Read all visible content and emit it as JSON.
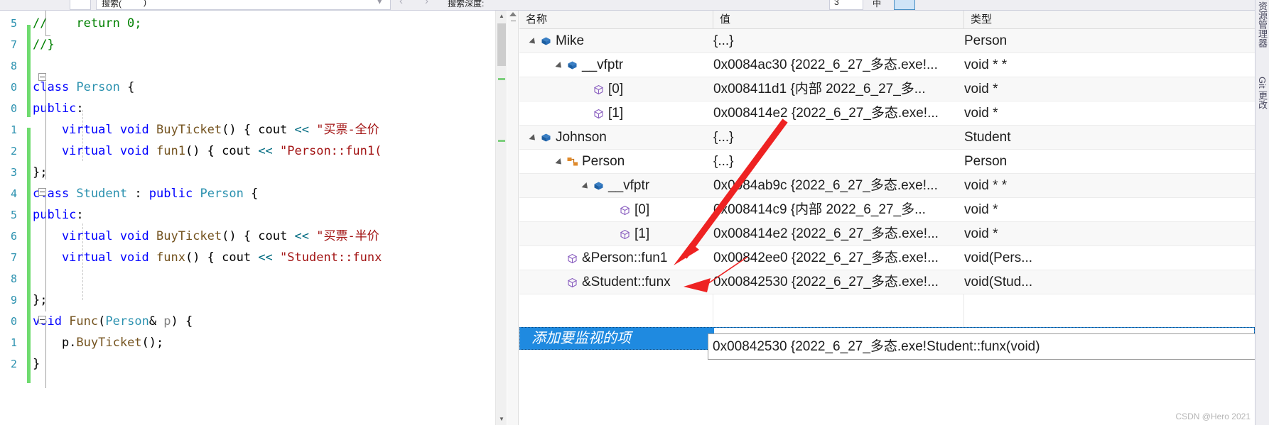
{
  "toolbar": {
    "search_dropdown_placeholder": "搜索(",
    "search_dropdown_suffix": ")",
    "search_depth_label": "搜索深度:",
    "search_depth_value": "3",
    "prev_arrow": "‹",
    "next_arrow": "›"
  },
  "editor": {
    "line_numbers": [
      "5",
      "7",
      "8",
      "0",
      "0",
      "1",
      "2",
      "3",
      "4",
      "5",
      "6",
      "7",
      "8",
      "9",
      "0",
      "1",
      "2"
    ],
    "lines": [
      {
        "indent": 0,
        "tokens": [
          {
            "t": "//    return 0;",
            "c": "cmt"
          }
        ]
      },
      {
        "indent": 0,
        "tokens": [
          {
            "t": "//}",
            "c": "cmt"
          }
        ]
      },
      {
        "indent": 0,
        "tokens": []
      },
      {
        "indent": 0,
        "tokens": [
          {
            "t": "class ",
            "c": "kw"
          },
          {
            "t": "Person",
            "c": "type"
          },
          {
            "t": " {",
            "c": "plain"
          }
        ]
      },
      {
        "indent": 0,
        "tokens": [
          {
            "t": "public",
            "c": "kw"
          },
          {
            "t": ":",
            "c": "plain"
          }
        ]
      },
      {
        "indent": 0,
        "tokens": [
          {
            "t": "    virtual void ",
            "c": "kw"
          },
          {
            "t": "BuyTicket",
            "c": "fn"
          },
          {
            "t": "() { cout ",
            "c": "plain"
          },
          {
            "t": "<<",
            "c": "op"
          },
          {
            "t": " \"买票-全价",
            "c": "str"
          }
        ]
      },
      {
        "indent": 0,
        "tokens": [
          {
            "t": "    virtual void ",
            "c": "kw"
          },
          {
            "t": "fun1",
            "c": "fn"
          },
          {
            "t": "() { cout ",
            "c": "plain"
          },
          {
            "t": "<<",
            "c": "op"
          },
          {
            "t": " \"Person::fun1(",
            "c": "str"
          }
        ]
      },
      {
        "indent": 0,
        "tokens": [
          {
            "t": "};",
            "c": "plain"
          }
        ]
      },
      {
        "indent": 0,
        "tokens": [
          {
            "t": "class ",
            "c": "kw"
          },
          {
            "t": "Student",
            "c": "type"
          },
          {
            "t": " : ",
            "c": "plain"
          },
          {
            "t": "public ",
            "c": "kw"
          },
          {
            "t": "Person",
            "c": "type"
          },
          {
            "t": " {",
            "c": "plain"
          }
        ]
      },
      {
        "indent": 0,
        "tokens": [
          {
            "t": "public",
            "c": "kw"
          },
          {
            "t": ":",
            "c": "plain"
          }
        ]
      },
      {
        "indent": 0,
        "tokens": [
          {
            "t": "    virtual void ",
            "c": "kw"
          },
          {
            "t": "BuyTicket",
            "c": "fn"
          },
          {
            "t": "() { cout ",
            "c": "plain"
          },
          {
            "t": "<<",
            "c": "op"
          },
          {
            "t": " \"买票-半价",
            "c": "str"
          }
        ]
      },
      {
        "indent": 0,
        "tokens": [
          {
            "t": "    virtual void ",
            "c": "kw"
          },
          {
            "t": "funx",
            "c": "fn"
          },
          {
            "t": "() { cout ",
            "c": "plain"
          },
          {
            "t": "<<",
            "c": "op"
          },
          {
            "t": " \"Student::funx",
            "c": "str"
          }
        ]
      },
      {
        "indent": 0,
        "tokens": []
      },
      {
        "indent": 0,
        "tokens": [
          {
            "t": "};",
            "c": "plain"
          }
        ]
      },
      {
        "indent": 0,
        "tokens": [
          {
            "t": "void ",
            "c": "kw"
          },
          {
            "t": "Func",
            "c": "fn"
          },
          {
            "t": "(",
            "c": "plain"
          },
          {
            "t": "Person",
            "c": "type"
          },
          {
            "t": "& ",
            "c": "plain"
          },
          {
            "t": "p",
            "c": "par"
          },
          {
            "t": ") {",
            "c": "plain"
          }
        ]
      },
      {
        "indent": 0,
        "tokens": [
          {
            "t": "    p.",
            "c": "plain"
          },
          {
            "t": "BuyTicket",
            "c": "fn"
          },
          {
            "t": "();",
            "c": "plain"
          }
        ]
      },
      {
        "indent": 0,
        "tokens": [
          {
            "t": "}",
            "c": "plain"
          }
        ]
      }
    ]
  },
  "watch": {
    "columns": [
      "名称",
      "值",
      "类型"
    ],
    "rows": [
      {
        "depth": 0,
        "expander": "expanded",
        "icon": "blue-cube",
        "name": "Mike",
        "value": "{...}",
        "type": "Person"
      },
      {
        "depth": 1,
        "expander": "expanded",
        "icon": "blue-cube",
        "name": "__vfptr",
        "value": "0x0084ac30 {2022_6_27_多态.exe!...",
        "type": "void * *"
      },
      {
        "depth": 2,
        "expander": "none",
        "icon": "purple-cube",
        "name": "[0]",
        "value": "0x008411d1 {内部 2022_6_27_多...",
        "type": "void *"
      },
      {
        "depth": 2,
        "expander": "none",
        "icon": "purple-cube",
        "name": "[1]",
        "value": "0x008414e2 {2022_6_27_多态.exe!...",
        "type": "void *"
      },
      {
        "depth": 0,
        "expander": "expanded",
        "icon": "blue-cube",
        "name": "Johnson",
        "value": "{...}",
        "type": "Student"
      },
      {
        "depth": 1,
        "expander": "expanded",
        "icon": "orange-base",
        "name": "Person",
        "value": "{...}",
        "type": "Person"
      },
      {
        "depth": 2,
        "expander": "expanded",
        "icon": "blue-cube",
        "name": "__vfptr",
        "value": "0x0084ab9c {2022_6_27_多态.exe!...",
        "type": "void * *"
      },
      {
        "depth": 3,
        "expander": "none",
        "icon": "purple-cube",
        "name": "[0]",
        "value": "0x008414c9 {内部 2022_6_27_多...",
        "type": "void *"
      },
      {
        "depth": 3,
        "expander": "none",
        "icon": "purple-cube",
        "name": "[1]",
        "value": "0x008414e2 {2022_6_27_多态.exe!...",
        "type": "void *"
      },
      {
        "depth": 1,
        "expander": "none",
        "icon": "purple-cube",
        "name": "&Person::fun1",
        "value": "0x00842ee0 {2022_6_27_多态.exe!...",
        "type": "void(Pers..."
      },
      {
        "depth": 1,
        "expander": "none",
        "icon": "purple-cube",
        "name": "&Student::funx",
        "value": "0x00842530 {2022_6_27_多态.exe!...",
        "type": "void(Stud..."
      }
    ],
    "add_watch_placeholder": "添加要监视的项",
    "tooltip_text": "0x00842530 {2022_6_27_多态.exe!Student::funx(void)"
  },
  "right_dock": {
    "tabs": [
      "资源管理器",
      "Git 更改"
    ]
  },
  "watermark": "CSDN @Hero 2021",
  "colors": {
    "selection_blue": "#1f8ae0",
    "arrow_red": "#ee2222",
    "change_bar_green": "#6fdb6f",
    "keyword_blue": "#0000ff",
    "type_teal": "#2b91af",
    "string_red": "#a31515",
    "comment_green": "#008000",
    "function_brown": "#74531f"
  }
}
